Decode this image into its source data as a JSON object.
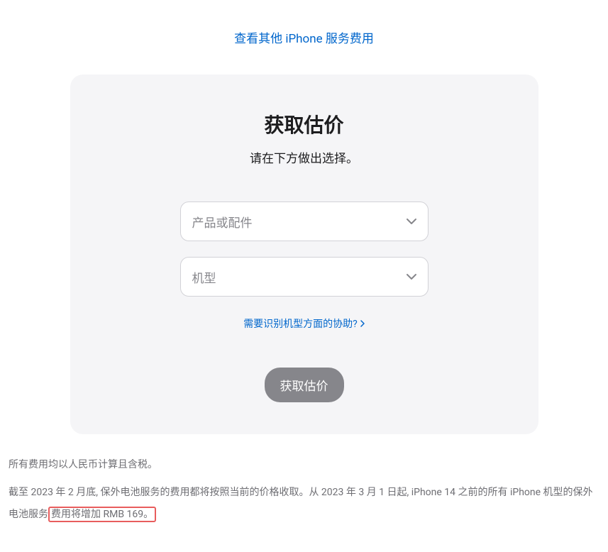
{
  "top_link": {
    "label": "查看其他 iPhone 服务费用"
  },
  "card": {
    "title": "获取估价",
    "subtitle": "请在下方做出选择。",
    "product_placeholder": "产品或配件",
    "model_placeholder": "机型",
    "help_label": "需要识别机型方面的协助?",
    "button_label": "获取估价"
  },
  "footer": {
    "line1": "所有费用均以人民币计算且含税。",
    "line2_pre": "截至 2023 年 2 月底, 保外电池服务的费用都将按照当前的价格收取。从 2023 年 3 月 1 日起, iPhone 14 之前的所有 iPhone 机型的保外电池服务",
    "line2_highlight": "费用将增加 RMB 169。"
  }
}
